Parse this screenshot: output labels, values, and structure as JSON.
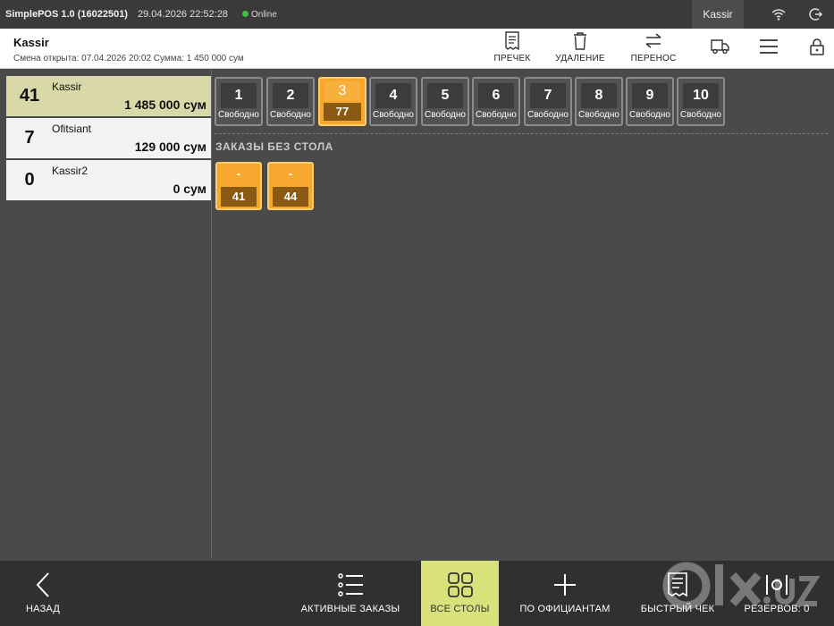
{
  "titlebar": {
    "app_title": "SimplePOS 1.0 (16022501)",
    "datetime": "29.04.2026 22:52:28",
    "status": "Online",
    "user": "Kassir",
    "icons": [
      "wifi-icon",
      "logout-icon"
    ]
  },
  "header": {
    "title": "Kassir",
    "shift_info": "Смена открыта: 07.04.2026 20:02 Сумма: 1 450 000 сум",
    "actions": [
      {
        "label": "ПРЕЧЕК",
        "icon": "receipt-icon"
      },
      {
        "label": "УДАЛЕНИЕ",
        "icon": "trash-icon"
      },
      {
        "label": "ПЕРЕНОС",
        "icon": "transfer-icon"
      }
    ],
    "icon_buttons": [
      "delivery-truck-icon",
      "menu-icon",
      "lock-icon"
    ]
  },
  "waiters": [
    {
      "count": "41",
      "name": "Kassir",
      "sum": "1 485 000 сум",
      "active": true
    },
    {
      "count": "7",
      "name": "Ofitsiant",
      "sum": "129 000 сум",
      "active": false
    },
    {
      "count": "0",
      "name": "Kassir2",
      "sum": "0 сум",
      "active": false
    }
  ],
  "tables": [
    {
      "number": "1",
      "status": "Свободно",
      "busy": false
    },
    {
      "number": "2",
      "status": "Свободно",
      "busy": false
    },
    {
      "number": "3",
      "status": "77",
      "busy": true
    },
    {
      "number": "4",
      "status": "Свободно",
      "busy": false
    },
    {
      "number": "5",
      "status": "Свободно",
      "busy": false
    },
    {
      "number": "6",
      "status": "Свободно",
      "busy": false
    },
    {
      "number": "7",
      "status": "Свободно",
      "busy": false
    },
    {
      "number": "8",
      "status": "Свободно",
      "busy": false
    },
    {
      "number": "9",
      "status": "Свободно",
      "busy": false
    },
    {
      "number": "10",
      "status": "Свободно",
      "busy": false
    }
  ],
  "no_table_section": {
    "label": "ЗАКАЗЫ БЕЗ СТОЛА",
    "orders": [
      {
        "table": "-",
        "number": "41"
      },
      {
        "table": "-",
        "number": "44"
      }
    ]
  },
  "bottombar": {
    "back": "НАЗАД",
    "active_orders": "АКТИВНЫЕ ЗАКАЗЫ",
    "all_tables": "ВСЕ СТОЛЫ",
    "by_waiters": "ПО ОФИЦИАНТАМ",
    "quick_check": "БЫСТРЫЙ ЧЕК",
    "reserves": "РЕЗЕРВОВ: 0",
    "active_tab": "all_tables"
  },
  "colors": {
    "busy_table": "#f6a72d",
    "active_waiter": "#d9d8a8",
    "active_tab": "#d9e27a",
    "online_dot": "#3fc23f"
  }
}
